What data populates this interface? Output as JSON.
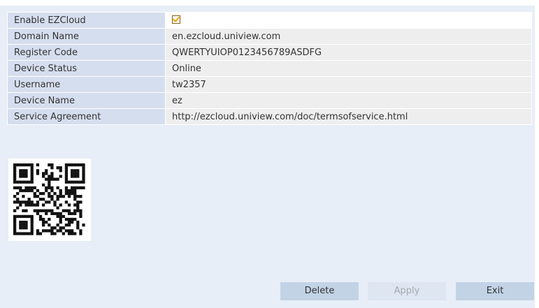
{
  "form": {
    "rows": [
      {
        "label": "Enable EZCloud",
        "value": "",
        "checked": true
      },
      {
        "label": "Domain Name",
        "value": "en.ezcloud.uniview.com"
      },
      {
        "label": "Register Code",
        "value": "QWERTYUIOP0123456789ASDFG"
      },
      {
        "label": "Device Status",
        "value": "Online"
      },
      {
        "label": "Username",
        "value": "tw2357"
      },
      {
        "label": "Device Name",
        "value": "ez"
      },
      {
        "label": "Service Agreement",
        "value": "http://ezcloud.uniview.com/doc/termsofservice.html"
      }
    ]
  },
  "qr": {
    "icon": "qr-code-icon"
  },
  "buttons": {
    "delete": "Delete",
    "apply": "Apply",
    "exit": "Exit"
  },
  "colors": {
    "panel_bg": "#e7eef7",
    "label_bg": "#d5deee",
    "value_bg": "#eeeeee",
    "button_bg": "#c2d3e6",
    "check_accent": "#f0a300"
  }
}
